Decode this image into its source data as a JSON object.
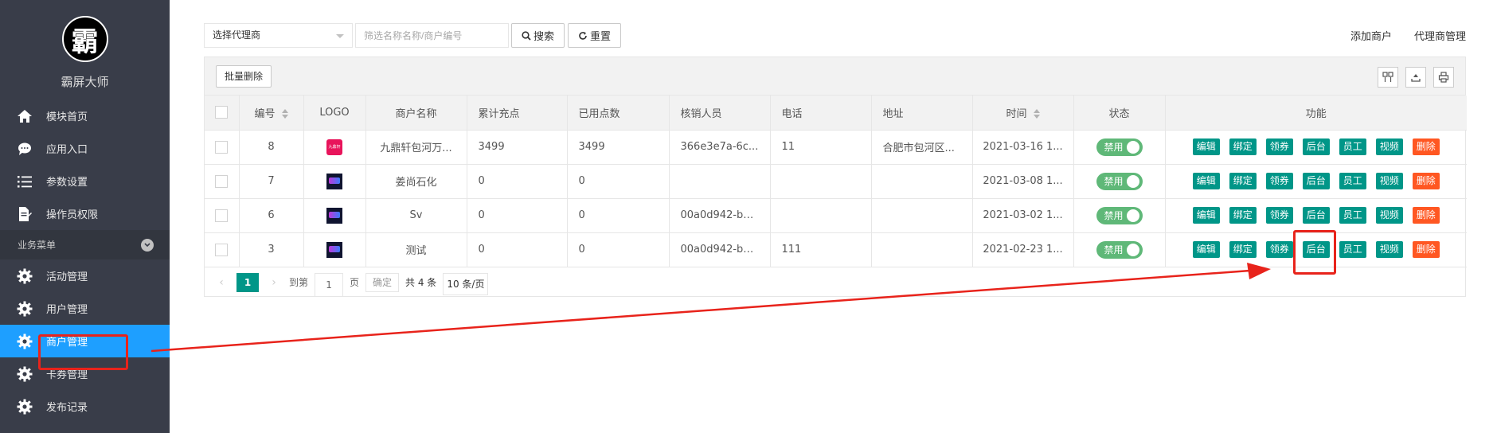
{
  "brand": {
    "logo_char": "霸",
    "name": "霸屏大师"
  },
  "sidebar": {
    "items_top": [
      {
        "label": "模块首页",
        "icon": "home-icon"
      },
      {
        "label": "应用入口",
        "icon": "chat-icon"
      },
      {
        "label": "参数设置",
        "icon": "list-icon"
      },
      {
        "label": "操作员权限",
        "icon": "document-icon"
      }
    ],
    "group": {
      "label": "业务菜单",
      "icon": "chevron-down-icon"
    },
    "items_group": [
      {
        "label": "活动管理",
        "icon": "gear-icon"
      },
      {
        "label": "用户管理",
        "icon": "gear-icon"
      },
      {
        "label": "商户管理",
        "icon": "gear-icon",
        "active": true
      },
      {
        "label": "卡券管理",
        "icon": "gear-icon"
      },
      {
        "label": "发布记录",
        "icon": "gear-icon"
      }
    ]
  },
  "filters": {
    "agent_select": "选择代理商",
    "search_placeholder": "筛选名称名称/商户编号",
    "search_button": "搜索",
    "reset_button": "重置"
  },
  "top_links": {
    "add_merchant": "添加商户",
    "agent_manage": "代理商管理"
  },
  "toolbar": {
    "batch_delete": "批量删除"
  },
  "table": {
    "headers": {
      "id": "编号",
      "logo": "LOGO",
      "name": "商户名称",
      "total_points": "累计充点",
      "used_points": "已用点数",
      "verifier": "核销人员",
      "phone": "电话",
      "address": "地址",
      "time": "时间",
      "status": "状态",
      "functions": "功能"
    },
    "rows": [
      {
        "id": "8",
        "logo": "red",
        "logo_text": "九鼎轩",
        "name": "九鼎轩包河万...",
        "total": "3499",
        "used": "3499",
        "verifier": "366e3e7a-6c...",
        "phone": "11",
        "address": "合肥市包河区...",
        "time": "2021-03-16 1...",
        "status": "禁用"
      },
      {
        "id": "7",
        "logo": "dark",
        "logo_text": "",
        "name": "姜尚石化",
        "total": "0",
        "used": "0",
        "verifier": "",
        "phone": "",
        "address": "",
        "time": "2021-03-08 1...",
        "status": "禁用"
      },
      {
        "id": "6",
        "logo": "dark",
        "logo_text": "",
        "name": "Sv",
        "total": "0",
        "used": "0",
        "verifier": "00a0d942-bd...",
        "phone": "",
        "address": "",
        "time": "2021-03-02 1...",
        "status": "禁用"
      },
      {
        "id": "3",
        "logo": "dark",
        "logo_text": "",
        "name": "测试",
        "total": "0",
        "used": "0",
        "verifier": "00a0d942-bd...",
        "phone": "111",
        "address": "",
        "time": "2021-02-23 1...",
        "status": "禁用"
      }
    ],
    "function_buttons": [
      "编辑",
      "绑定",
      "领券",
      "后台",
      "员工",
      "视频",
      "删除"
    ]
  },
  "pagination": {
    "current": "1",
    "goto_label": "到第",
    "page_input": "1",
    "page_unit": "页",
    "confirm": "确定",
    "total": "共 4 条",
    "page_size": "10 条/页"
  },
  "colors": {
    "sidebar_bg": "#393d49",
    "active": "#1e9fff",
    "teal": "#009688",
    "danger": "#ff5722",
    "toggle": "#5fb878",
    "annotation": "#e8231b"
  }
}
